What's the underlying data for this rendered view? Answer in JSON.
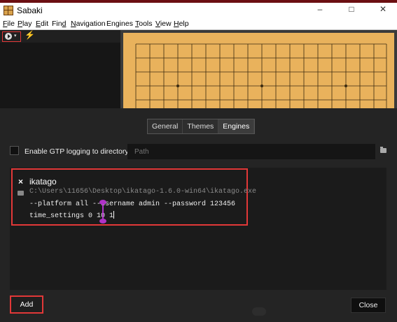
{
  "window": {
    "title": "Sabaki",
    "minimize": "–",
    "maximize": "□",
    "close": "✕"
  },
  "menu": [
    {
      "label": "File",
      "accel": "F",
      "rest": "ile"
    },
    {
      "label": "Play",
      "accel": "P",
      "rest": "lay"
    },
    {
      "label": "Edit",
      "accel": "E",
      "rest": "dit"
    },
    {
      "label": "Find",
      "accel": "",
      "rest": "Fin",
      "accel_after": "d"
    },
    {
      "label": "Navigation",
      "accel": "N",
      "rest": "avigation"
    },
    {
      "label": "Engines",
      "accel": "",
      "rest": "Engines"
    },
    {
      "label": "Tools",
      "accel": "T",
      "rest": "ools"
    },
    {
      "label": "View",
      "accel": "V",
      "rest": "iew"
    },
    {
      "label": "Help",
      "accel": "H",
      "rest": "elp"
    }
  ],
  "toolbar": {
    "play_caret": "▾",
    "flash_symbol": "⚡"
  },
  "tabs": [
    {
      "label": "General",
      "active": false
    },
    {
      "label": "Themes",
      "active": false
    },
    {
      "label": "Engines",
      "active": true
    }
  ],
  "gtp": {
    "label": "Enable GTP logging to directory:",
    "placeholder": "Path"
  },
  "engine": {
    "remove_symbol": "×",
    "name": "ikatago",
    "path": "C:\\Users\\11656\\Desktop\\ikatago-1.6.0-win64\\ikatago.exe",
    "arguments": "--platform all --username admin --password 123456",
    "commands": "time_settings 0 10 1"
  },
  "buttons": {
    "add": "Add",
    "close": "Close"
  },
  "colors": {
    "highlight": "#e23838",
    "board": "#e9b25c",
    "cursor": "#b033c8"
  }
}
